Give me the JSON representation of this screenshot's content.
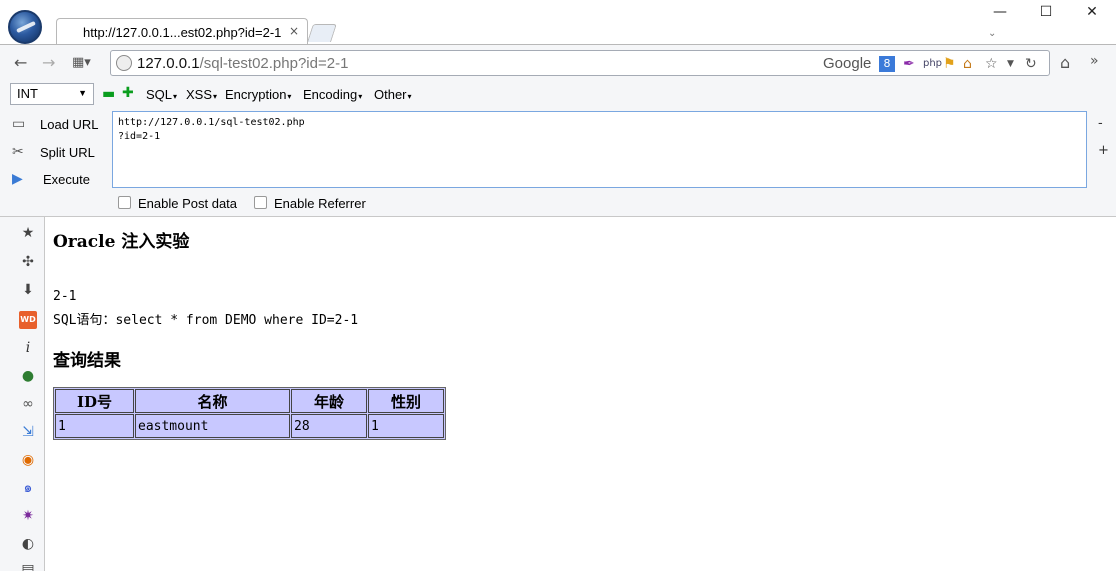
{
  "tab": {
    "title": "http://127.0.0.1...est02.php?id=2-1",
    "close": "×"
  },
  "window": {
    "minimize": "—",
    "maximize": "☐",
    "close": "✕"
  },
  "address_bar": {
    "host": "127.0.0.1",
    "path": "/sql-test02.php?id=2-1",
    "search_engine": "Google"
  },
  "hackbar": {
    "type_select": "INT",
    "menus": [
      "SQL",
      "XSS",
      "Encryption",
      "Encoding",
      "Other"
    ],
    "actions": [
      "Load URL",
      "Split URL",
      "Execute"
    ],
    "url_text": "http://127.0.0.1/sql-test02.php\n?id=2-1",
    "side_minus": "-",
    "side_plus": "+",
    "checkboxes": [
      "Enable Post data",
      "Enable Referrer"
    ]
  },
  "page": {
    "title": "Oracle 注入实验",
    "input_value": "2-1",
    "sql_line": "SQL语句：select * from DEMO where ID=2-1",
    "result_heading": "查询结果",
    "table": {
      "headers": [
        "ID号",
        "名称",
        "年龄",
        "性别"
      ],
      "rows": [
        [
          "1",
          "eastmount",
          "28",
          "1"
        ]
      ]
    }
  },
  "colors": {
    "table_bg": "#c8c8ff",
    "accent": "#3b7ad9"
  }
}
